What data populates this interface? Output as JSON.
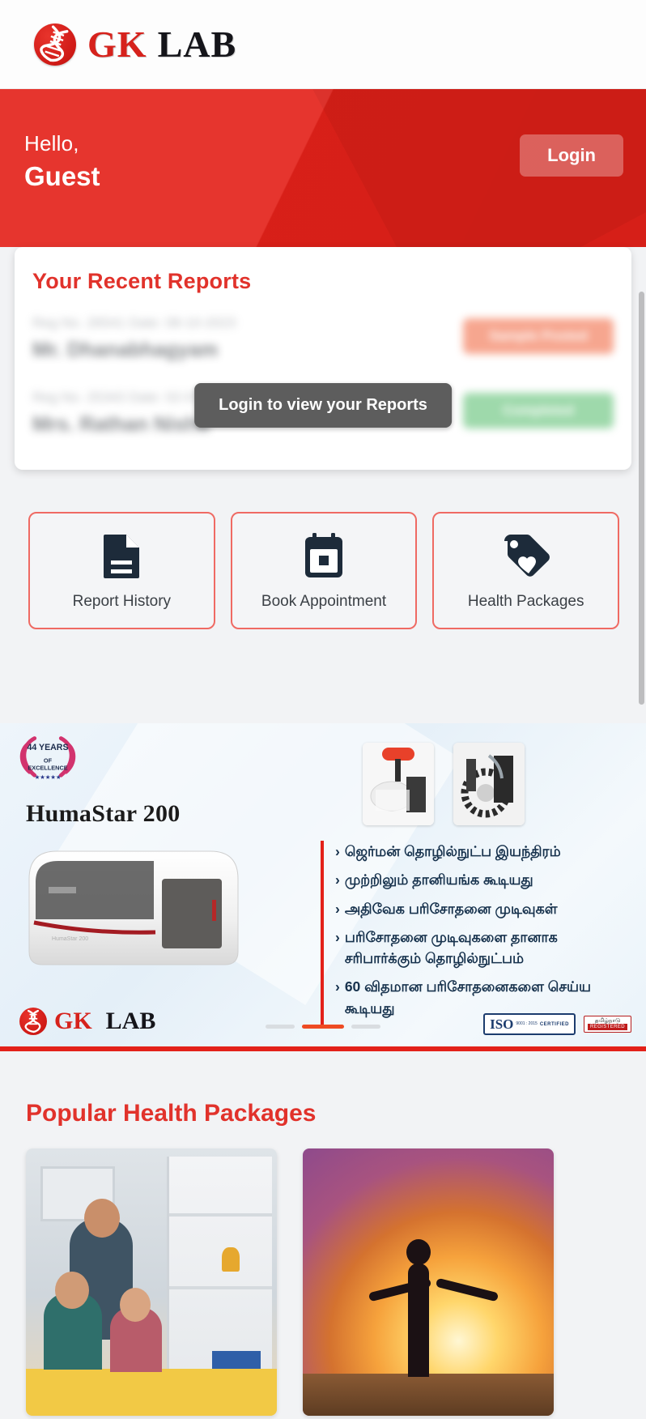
{
  "app": {
    "brand_primary": "GK",
    "brand_secondary": "LAB",
    "accent_red": "#e32119",
    "title_red": "#e1322b",
    "icon_navy": "#1d2b3a"
  },
  "hero": {
    "greeting": "Hello,",
    "user_name": "Guest",
    "login_label": "Login"
  },
  "recent_reports": {
    "title": "Your Recent Reports",
    "tooltip": "Login to view your Reports",
    "rows": [
      {
        "meta": "Reg No. 26541 Date: 08-10-2023",
        "name": "Mr. Dhanabhagyam",
        "badge": "Sample Posted",
        "badge_color": "#f2704b"
      },
      {
        "meta": "Reg No. 25343 Date: 02-07-2023",
        "name": "Mrs. Rathan Nisha",
        "badge": "Completed",
        "badge_color": "#63c278"
      }
    ]
  },
  "quick_actions": [
    {
      "label": "Report History",
      "icon": "document-icon"
    },
    {
      "label": "Book Appointment",
      "icon": "calendar-icon"
    },
    {
      "label": "Health Packages",
      "icon": "tag-heart-icon"
    }
  ],
  "banner": {
    "award_badge": "44 YEARS OF EXCELLENCE",
    "product_title": "HumaStar 200",
    "bullets": [
      "ஜெர்மன் தொழில்நுட்ப இயந்திரம்",
      "முற்றிலும் தானியங்க கூடியது",
      "அதிவேக பரிசோதனை முடிவுகள்",
      "பரிசோதனை முடிவுகளை தானாக சரிபார்க்கும் தொழில்நுட்பம்",
      "60 விதமான பரிசோதனைகளை செய்ய கூடியது"
    ],
    "footer_brand_primary": "GK",
    "footer_brand_secondary": "LAB",
    "cert_iso_main": "ISO",
    "cert_iso_lines": "9001 : 2015",
    "cert_iso_sub": "CERTIFIED",
    "cert_reg_line1": "தமிழ்நாடு",
    "cert_reg_line2": "REGISTERED",
    "carousel_total_dots": 3,
    "carousel_active_index": 1
  },
  "packages": {
    "title": "Popular Health Packages",
    "cards": [
      {
        "image_alt": "family-at-home-photo"
      },
      {
        "image_alt": "woman-sunset-silhouette-photo"
      }
    ]
  }
}
